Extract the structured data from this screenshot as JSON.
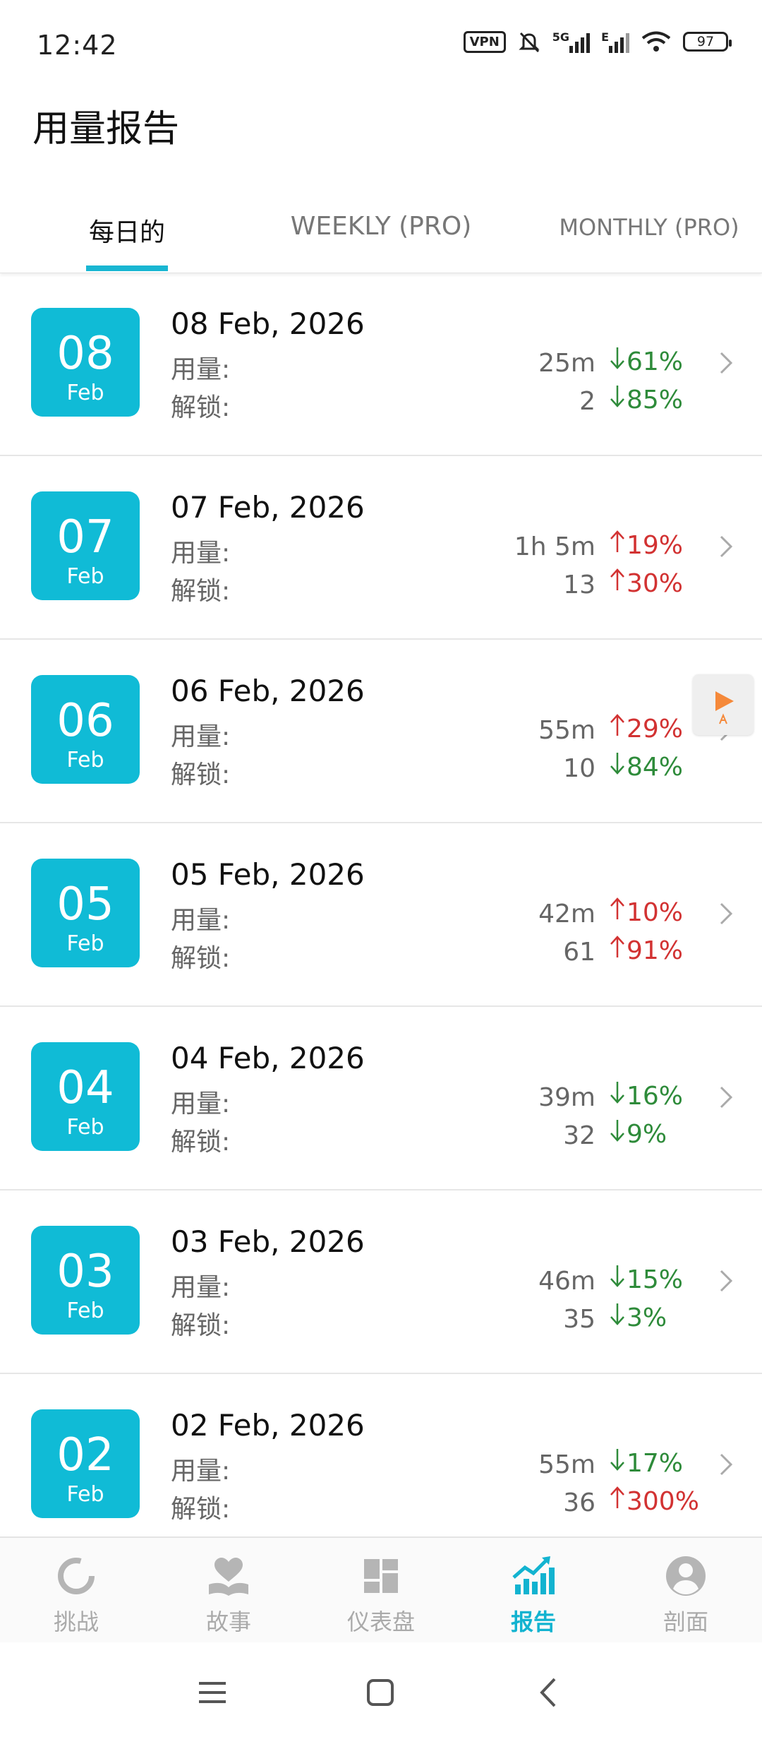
{
  "status_bar": {
    "time": "12:42",
    "vpn": "VPN",
    "net1": "5G",
    "net2": "E",
    "battery": "97"
  },
  "header": {
    "title": "用量报告"
  },
  "tabs": [
    {
      "label": "每日的",
      "active": true
    },
    {
      "label": "WEEKLY (PRO)",
      "active": false
    },
    {
      "label": "MONTHLY (PRO)",
      "active": false
    }
  ],
  "labels": {
    "usage": "用量:",
    "unlock": "解锁:"
  },
  "reports": [
    {
      "day": "08",
      "month": "Feb",
      "date": "08 Feb, 2026",
      "usage": "25m",
      "usage_dir": "down",
      "usage_pct": "61%",
      "unlocks": "2",
      "unlock_dir": "down",
      "unlock_pct": "85%"
    },
    {
      "day": "07",
      "month": "Feb",
      "date": "07 Feb, 2026",
      "usage": "1h 5m",
      "usage_dir": "up",
      "usage_pct": "19%",
      "unlocks": "13",
      "unlock_dir": "up",
      "unlock_pct": "30%"
    },
    {
      "day": "06",
      "month": "Feb",
      "date": "06 Feb, 2026",
      "usage": "55m",
      "usage_dir": "up",
      "usage_pct": "29%",
      "unlocks": "10",
      "unlock_dir": "down",
      "unlock_pct": "84%"
    },
    {
      "day": "05",
      "month": "Feb",
      "date": "05 Feb, 2026",
      "usage": "42m",
      "usage_dir": "up",
      "usage_pct": "10%",
      "unlocks": "61",
      "unlock_dir": "up",
      "unlock_pct": "91%"
    },
    {
      "day": "04",
      "month": "Feb",
      "date": "04 Feb, 2026",
      "usage": "39m",
      "usage_dir": "down",
      "usage_pct": "16%",
      "unlocks": "32",
      "unlock_dir": "down",
      "unlock_pct": "9%"
    },
    {
      "day": "03",
      "month": "Feb",
      "date": "03 Feb, 2026",
      "usage": "46m",
      "usage_dir": "down",
      "usage_pct": "15%",
      "unlocks": "35",
      "unlock_dir": "down",
      "unlock_pct": "3%"
    },
    {
      "day": "02",
      "month": "Feb",
      "date": "02 Feb, 2026",
      "usage": "55m",
      "usage_dir": "down",
      "usage_pct": "17%",
      "unlocks": "36",
      "unlock_dir": "up",
      "unlock_pct": "300%"
    }
  ],
  "bottom_nav": [
    {
      "label": "挑战",
      "icon": "challenge-icon",
      "active": false
    },
    {
      "label": "故事",
      "icon": "story-icon",
      "active": false
    },
    {
      "label": "仪表盘",
      "icon": "dashboard-icon",
      "active": false
    },
    {
      "label": "报告",
      "icon": "report-icon",
      "active": true
    },
    {
      "label": "剖面",
      "icon": "profile-icon",
      "active": false
    }
  ],
  "colors": {
    "accent": "#10bbd6",
    "down": "#2e8b3a",
    "up": "#d23232"
  }
}
